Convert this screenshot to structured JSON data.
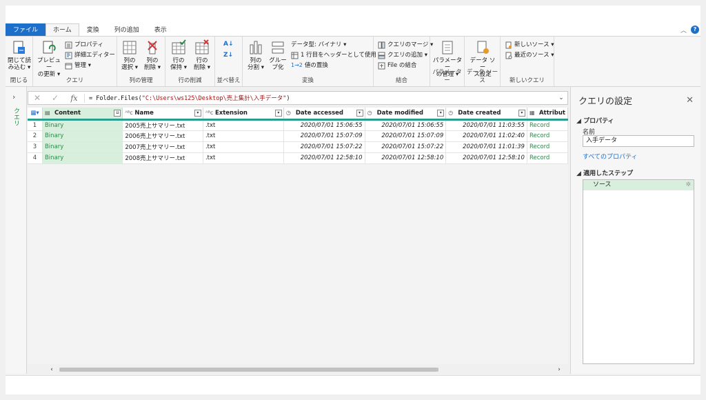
{
  "ribbon_tabs": [
    "ファイル",
    "ホーム",
    "変換",
    "列の追加",
    "表示"
  ],
  "ribbon": {
    "close_load": "閉じて読\nみ込む",
    "close_load_a": "閉じて読",
    "close_load_b": "み込む ▾",
    "preview_a": "プレビュー",
    "preview_b": "の更新 ▾",
    "properties": "プロパティ",
    "advanced_editor": "詳細エディター",
    "manage": "管理 ▾",
    "select_cols_a": "列の",
    "select_cols_b": "選択 ▾",
    "remove_cols_a": "列の",
    "remove_cols_b": "削除 ▾",
    "keep_rows_a": "行の",
    "keep_rows_b": "保持 ▾",
    "remove_rows_a": "行の",
    "remove_rows_b": "削除 ▾",
    "split_a": "列の",
    "split_b": "分割 ▾",
    "group_a": "グルー",
    "group_b": "プ化",
    "data_type": "データ型: バイナリ ▾",
    "first_row_header": "1 行目をヘッダーとして使用 ▾",
    "replace_values": "値の置換",
    "merge_queries": "クエリのマージ ▾",
    "append_queries": "クエリの追加 ▾",
    "combine_files": "File の結合",
    "params_a": "パラメーター",
    "params_b": "の管理 ▾",
    "ds_a": "データ ソー",
    "ds_b": "ス設定",
    "new_source": "新しいソース ▾",
    "recent_sources": "最近のソース ▾",
    "groups": {
      "close": "閉じる",
      "query": "クエリ",
      "manage_cols": "列の管理",
      "reduce_rows": "行の削減",
      "sort": "並べ替え",
      "transform": "変換",
      "combine": "結合",
      "parameters": "パラメーター",
      "data_source": "データ ソース",
      "new_query": "新しいクエリ"
    }
  },
  "left_pane": {
    "label": "クエリ"
  },
  "formula": {
    "prefix": "= Folder.Files(",
    "string": "\"C:\\Users\\ws125\\Desktop\\売上集計\\入手データ\"",
    "suffix": ")"
  },
  "table": {
    "columns": [
      "Content",
      "Name",
      "Extension",
      "Date accessed",
      "Date modified",
      "Date created",
      "Attributes"
    ],
    "column_display": [
      "Content",
      "Name",
      "Extension",
      "Date accessed",
      "Date modified",
      "Date created",
      "Attribut"
    ],
    "rows": [
      {
        "n": "1",
        "content": "Binary",
        "name": "2005売上サマリー.txt",
        "ext": ".txt",
        "accessed": "2020/07/01 15:06:55",
        "modified": "2020/07/01 15:06:55",
        "created": "2020/07/01 11:03:55",
        "attr": "Record"
      },
      {
        "n": "2",
        "content": "Binary",
        "name": "2006売上サマリー.txt",
        "ext": ".txt",
        "accessed": "2020/07/01 15:07:09",
        "modified": "2020/07/01 15:07:09",
        "created": "2020/07/01 11:02:40",
        "attr": "Record"
      },
      {
        "n": "3",
        "content": "Binary",
        "name": "2007売上サマリー.txt",
        "ext": ".txt",
        "accessed": "2020/07/01 15:07:22",
        "modified": "2020/07/01 15:07:22",
        "created": "2020/07/01 11:01:39",
        "attr": "Record"
      },
      {
        "n": "4",
        "content": "Binary",
        "name": "2008売上サマリー.txt",
        "ext": ".txt",
        "accessed": "2020/07/01 12:58:10",
        "modified": "2020/07/01 12:58:10",
        "created": "2020/07/01 12:58:10",
        "attr": "Record"
      }
    ]
  },
  "settings": {
    "title": "クエリの設定",
    "properties_header": "プロパティ",
    "name_label": "名前",
    "name_value": "入手データ",
    "all_properties_link": "すべてのプロパティ",
    "steps_header": "適用したステップ",
    "steps": [
      "ソース"
    ]
  },
  "colors": {
    "accent": "#1e6fc9",
    "green": "#2a8a4a",
    "selected": "#d9efdd",
    "header_rule": "#2a9d8f"
  }
}
